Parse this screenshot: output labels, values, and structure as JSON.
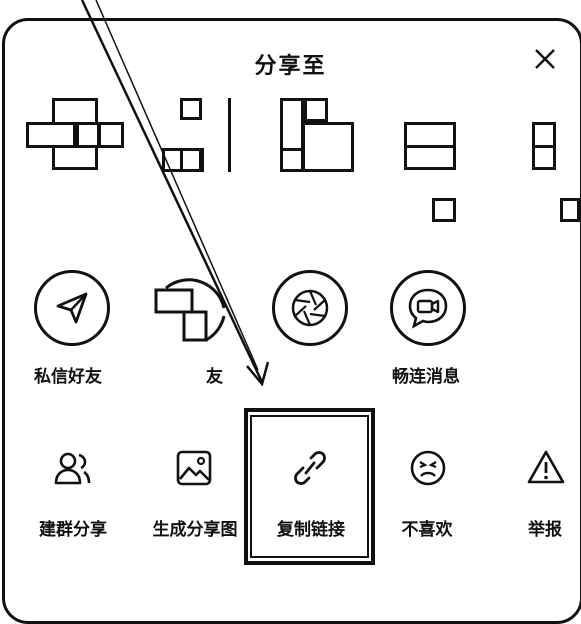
{
  "header": {
    "title": "分享至"
  },
  "friends_row": {
    "labels": [
      "私信好友",
      "友",
      "畅连消息"
    ]
  },
  "actions": [
    {
      "label": "建群分享"
    },
    {
      "label": "生成分享图"
    },
    {
      "label": "复制链接"
    },
    {
      "label": "不喜欢"
    },
    {
      "label": "举报"
    }
  ]
}
